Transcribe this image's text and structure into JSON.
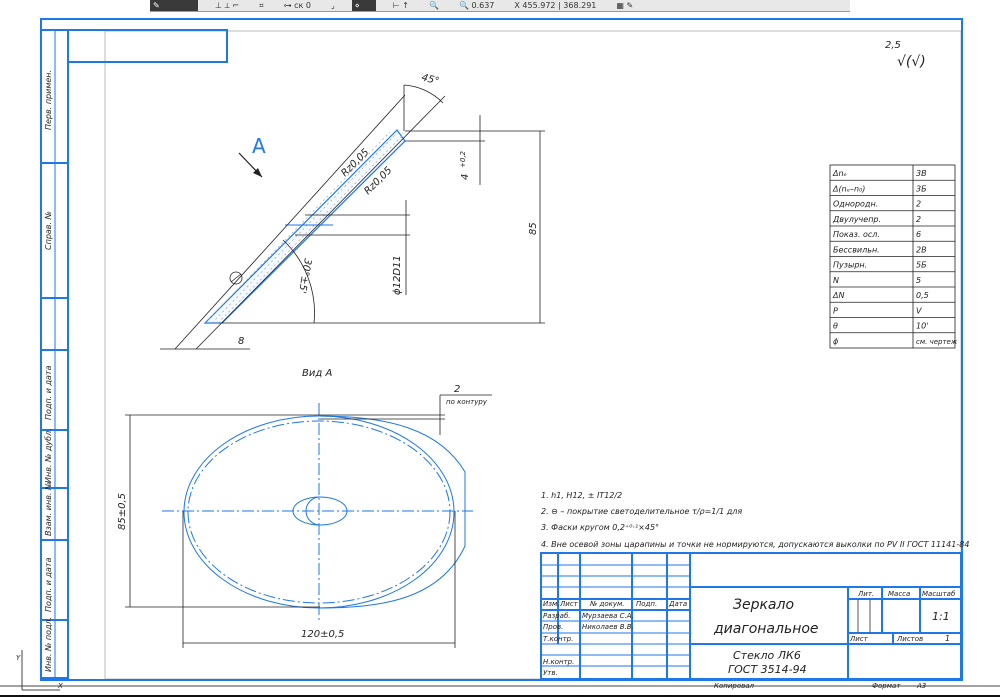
{
  "toolbar": {
    "step": "ск 0",
    "scale": "0.637",
    "x_label": "X",
    "x_value": "455.972",
    "y_value": "368.291"
  },
  "side_stamps": [
    "Перв. примен.",
    "Справ. №",
    "Подп. и дата",
    "Инв. № дубл.",
    "Взам. инв. №",
    "Подп. и дата",
    "Инв. № подл."
  ],
  "roughness": {
    "value": "2,5",
    "symbol": "√(√)"
  },
  "section": {
    "view_letter": "A",
    "angle_top": "45°",
    "thickness": "4",
    "thickness_tol": "+0,2",
    "rz1": "Rz0,05",
    "rz2": "Rz0,05",
    "height": "85",
    "hole": "ϕ12D11",
    "angle": "30°±5'",
    "offset": "8"
  },
  "view": {
    "title": "Вид А",
    "coating": "2",
    "coating_note": "по контуру",
    "height": "85±0,5",
    "width": "120±0,5"
  },
  "params": [
    [
      "Δnₑ",
      "3В"
    ],
    [
      "Δ(nₑ–n₀)",
      "3Б"
    ],
    [
      "Однородн.",
      "2"
    ],
    [
      "Двулучепр.",
      "2"
    ],
    [
      "Показ. осл.",
      "6"
    ],
    [
      "Бессвильн.",
      "2В"
    ],
    [
      "Пузырн.",
      "5Б"
    ],
    [
      "N",
      "5"
    ],
    [
      "ΔN",
      "0,5"
    ],
    [
      "P",
      "V"
    ],
    [
      "θ",
      "10'"
    ],
    [
      "ϕ",
      "см. чертеж"
    ]
  ],
  "notes": [
    "1. h1, H12, ± IT12/2",
    "2. ⊖ – покрытие светоделительное τ/ρ=1/1 для",
    "3. Фаски кругом 0,2⁺⁰·¹×45°",
    "4. Вне осевой зоны царапины и точки не нормируются, допускаются выколки по PV II ГОСТ 11141-84"
  ],
  "title_block": {
    "headers": [
      "Изм.",
      "Лист",
      "№ докум.",
      "Подп.",
      "Дата"
    ],
    "roles": [
      "Разраб.",
      "Пров.",
      "Т.контр.",
      "",
      "Н.контр.",
      "Утв."
    ],
    "names": [
      "Мурзаева С.А.",
      "Николаев В.В."
    ],
    "title_line1": "Зеркало",
    "title_line2": "диагональное",
    "material_line1": "Стекло ЛК6",
    "material_line2": "ГОСТ 3514-94",
    "lit": "Лит.",
    "mass": "Масса",
    "scale_label": "Масштаб",
    "scale": "1:1",
    "sheet": "Лист",
    "sheets": "Листов",
    "sheets_count": "1",
    "copied": "Копировал",
    "format_label": "Формат",
    "format": "А3"
  }
}
